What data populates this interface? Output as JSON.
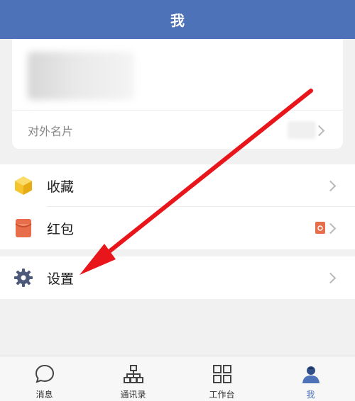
{
  "header": {
    "title": "我"
  },
  "profile": {
    "card_label": "对外名片"
  },
  "menu": {
    "favorites": "收藏",
    "red_packet": "红包",
    "settings": "设置"
  },
  "tabs": [
    {
      "label": "消息",
      "icon": "chat-bubble-icon"
    },
    {
      "label": "通讯录",
      "icon": "org-chart-icon"
    },
    {
      "label": "工作台",
      "icon": "grid-icon"
    },
    {
      "label": "我",
      "icon": "user-avatar-icon",
      "active": true
    }
  ],
  "colors": {
    "header_bg": "#4d72b7",
    "favorites_icon": "#f6c52e",
    "red_packet_icon": "#e86d4a",
    "settings_icon": "#4e5a7a",
    "annotation_arrow": "#e8151b"
  }
}
